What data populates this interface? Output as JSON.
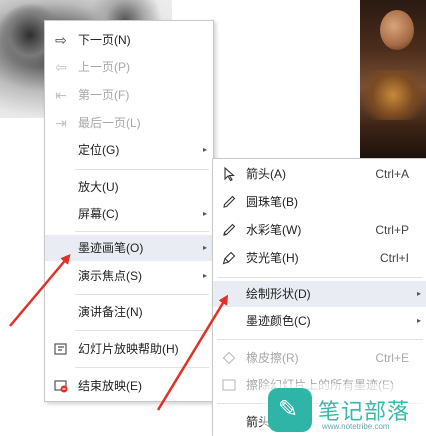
{
  "main_menu": {
    "items": [
      {
        "label": "下一页(N)",
        "icon": "arrow-right-outline-icon",
        "enabled": true
      },
      {
        "label": "上一页(P)",
        "icon": "arrow-left-outline-icon",
        "enabled": false
      },
      {
        "label": "第一页(F)",
        "icon": "arrow-first-outline-icon",
        "enabled": false
      },
      {
        "label": "最后一页(L)",
        "icon": "arrow-last-outline-icon",
        "enabled": false
      },
      {
        "label": "定位(G)",
        "enabled": true,
        "submenu": true
      },
      {
        "label": "放大(U)",
        "enabled": true
      },
      {
        "label": "屏幕(C)",
        "enabled": true,
        "submenu": true
      },
      {
        "label": "墨迹画笔(O)",
        "enabled": true,
        "submenu": true,
        "highlighted": true
      },
      {
        "label": "演示焦点(S)",
        "enabled": true,
        "submenu": true
      },
      {
        "label": "演讲备注(N)",
        "enabled": true
      },
      {
        "label": "幻灯片放映帮助(H)",
        "icon": "help-icon",
        "enabled": true
      },
      {
        "label": "结束放映(E)",
        "icon": "end-show-icon",
        "enabled": true
      }
    ]
  },
  "pen_submenu": {
    "items": [
      {
        "label": "箭头(A)",
        "shortcut": "Ctrl+A",
        "icon": "cursor-arrow-icon",
        "enabled": true
      },
      {
        "label": "圆珠笔(B)",
        "shortcut": "",
        "icon": "ballpoint-pen-icon",
        "enabled": true
      },
      {
        "label": "水彩笔(W)",
        "shortcut": "Ctrl+P",
        "icon": "watercolor-pen-icon",
        "enabled": true
      },
      {
        "label": "荧光笔(H)",
        "shortcut": "Ctrl+I",
        "icon": "highlighter-icon",
        "enabled": true
      },
      {
        "label": "绘制形状(D)",
        "enabled": true,
        "submenu": true,
        "highlighted": true
      },
      {
        "label": "墨迹颜色(C)",
        "enabled": true,
        "submenu": true
      },
      {
        "label": "橡皮擦(R)",
        "shortcut": "Ctrl+E",
        "icon": "eraser-icon",
        "enabled": false
      },
      {
        "label": "擦除幻灯片上的所有墨迹(E)",
        "icon": "erase-all-icon",
        "enabled": false
      },
      {
        "label": "箭头",
        "enabled": true
      }
    ]
  },
  "symbols": {
    "submenu_arrow": "▸"
  },
  "watermark": {
    "text": "笔记部落",
    "url": "www.notetribe.com"
  },
  "colors": {
    "menu_highlight": "#e9edf3",
    "annotation_arrow": "#e0302a",
    "watermark_teal": "#2fb5a8"
  }
}
